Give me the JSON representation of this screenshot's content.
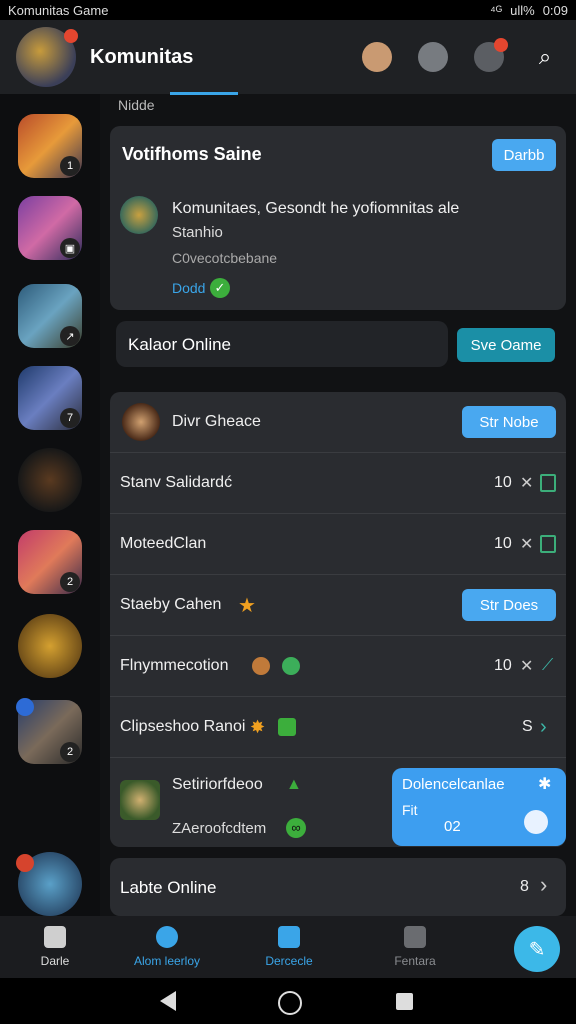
{
  "status_bar": {
    "app_name": "Komunitas Game",
    "signal": "⁴ᴳ",
    "battery": "ull%",
    "time": "0:09"
  },
  "header": {
    "title": "Komunitas"
  },
  "section": {
    "label": "Nidde"
  },
  "feature_card": {
    "title": "Votifhoms Saine",
    "button": "Darbb",
    "message": "Komunitaes, Gesondt he yofiomnitas ale",
    "message_line2": "Stanhio",
    "sub": "C0vecotcbebane",
    "status": "Dodd"
  },
  "online_bar": {
    "label": "Kalaor Online",
    "button": "Sve Oame"
  },
  "list": {
    "header_name": "Divr Gheace",
    "header_button": "Str Nobe",
    "rows": [
      {
        "name": "Stanv Salidardć",
        "value": "10"
      },
      {
        "name": "MoteedClan",
        "value": "10"
      },
      {
        "name": "Staeby Cahen",
        "button": "Str Does"
      },
      {
        "name": "Flnymmecotion",
        "value": "10"
      },
      {
        "name": "Clipseshoo Ranoi",
        "value": "S"
      }
    ],
    "last_name": "Setiriorfdeoo",
    "last_sub": "ZAeroofcdtem"
  },
  "popup": {
    "title": "Dolencelcanlae",
    "line": "Fit",
    "value": "02"
  },
  "bottom_card": {
    "label": "Labte Online",
    "count": "8"
  },
  "nav": [
    {
      "label": "Darle"
    },
    {
      "label": "Alom leerloy"
    },
    {
      "label": "Dercecle"
    },
    {
      "label": "Fentara"
    }
  ],
  "colors": {
    "accent": "#3aa5e8",
    "button": "#49a8f0",
    "teal": "#1b8fa6"
  }
}
